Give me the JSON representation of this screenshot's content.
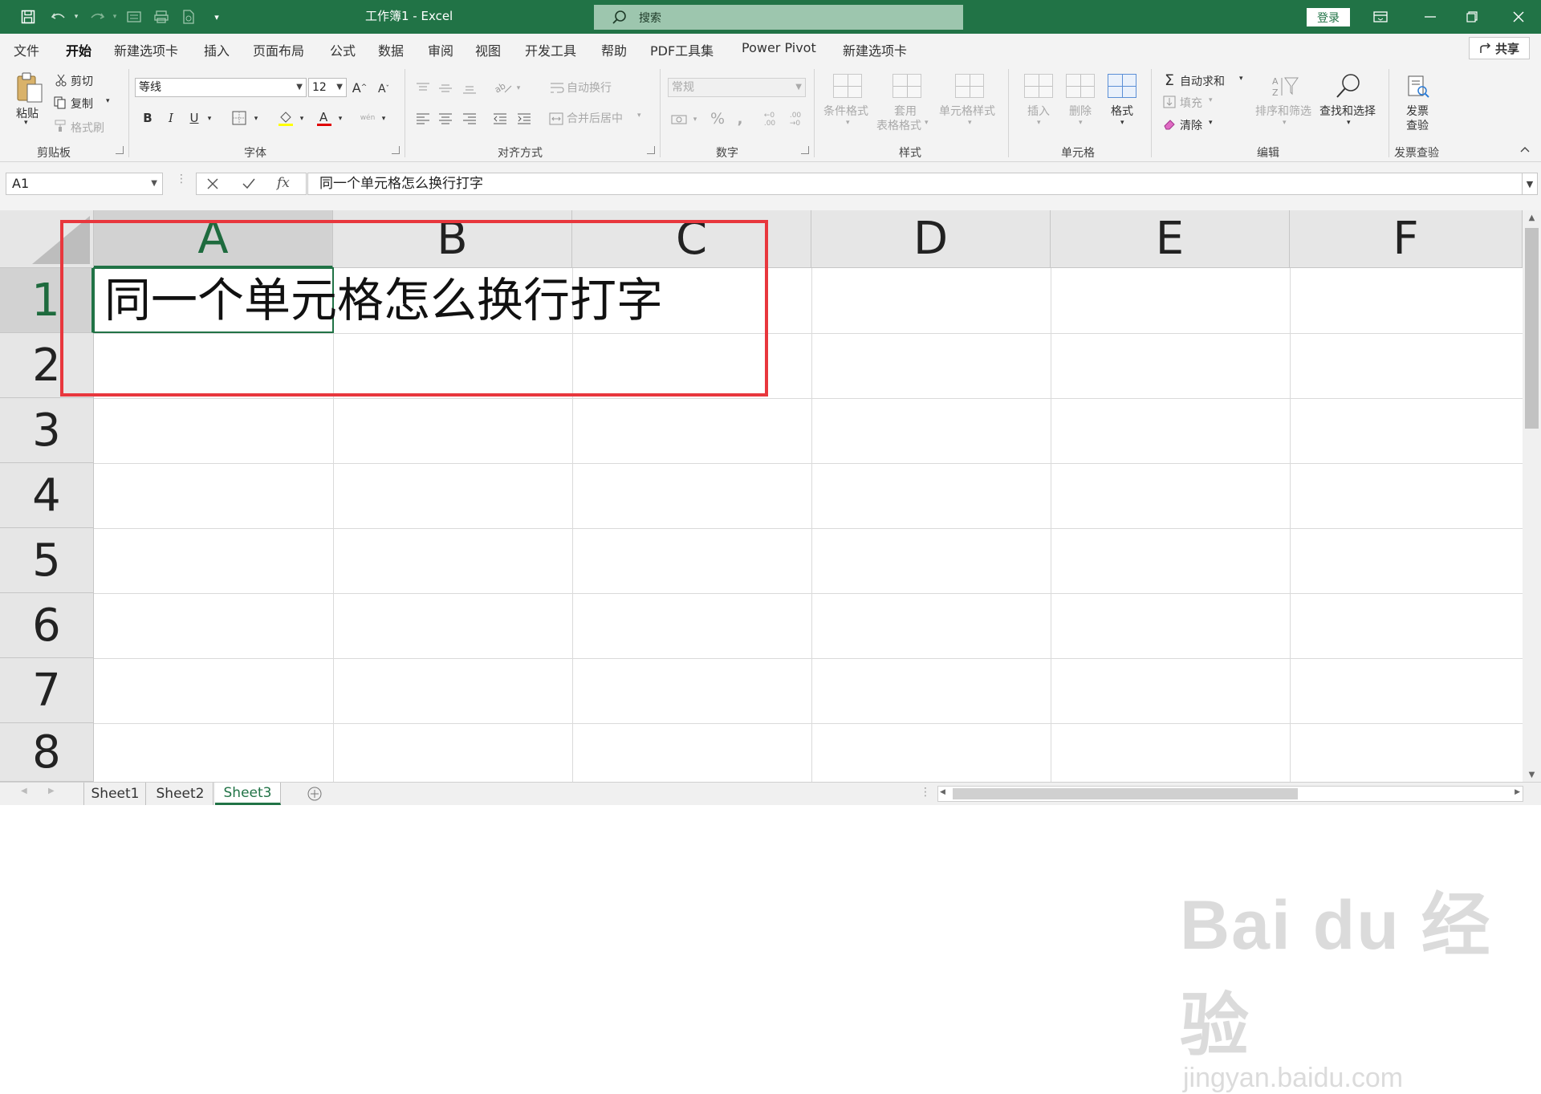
{
  "titlebar": {
    "title": "工作簿1  -  Excel",
    "search_placeholder": "搜索",
    "login_label": "登录"
  },
  "tabs": [
    "文件",
    "开始",
    "新建选项卡",
    "插入",
    "页面布局",
    "公式",
    "数据",
    "审阅",
    "视图",
    "开发工具",
    "帮助",
    "PDF工具集",
    "Power Pivot",
    "新建选项卡"
  ],
  "active_tab": "开始",
  "share_label": "共享",
  "ribbon": {
    "clipboard": {
      "paste": "粘贴",
      "cut": "剪切",
      "copy": "复制",
      "format_painter": "格式刷",
      "group": "剪贴板"
    },
    "font": {
      "name": "等线",
      "size": "12",
      "group": "字体"
    },
    "alignment": {
      "wrap": "自动换行",
      "merge": "合并后居中",
      "group": "对齐方式"
    },
    "number": {
      "format": "常规",
      "group": "数字"
    },
    "styles": {
      "conditional": "条件格式",
      "table_1": "套用",
      "table_2": "表格格式",
      "cell_styles": "单元格样式",
      "group": "样式"
    },
    "cells": {
      "insert": "插入",
      "delete": "删除",
      "format": "格式",
      "group": "单元格"
    },
    "editing": {
      "autosum": "自动求和",
      "fill": "填充",
      "clear": "清除",
      "sort": "排序和筛选",
      "find": "查找和选择",
      "group": "编辑"
    },
    "invoice": {
      "line1": "发票",
      "line2": "查验",
      "group": "发票查验"
    }
  },
  "formula_bar": {
    "name_box": "A1",
    "content": "同一个单元格怎么换行打字"
  },
  "grid": {
    "columns": [
      "A",
      "B",
      "C",
      "D",
      "E",
      "F"
    ],
    "rows": [
      "1",
      "2",
      "3",
      "4",
      "5",
      "6",
      "7",
      "8"
    ],
    "selected_cell": "A1",
    "a1_value": "同一个单元格怎么换行打字"
  },
  "sheets": [
    "Sheet1",
    "Sheet2",
    "Sheet3"
  ],
  "active_sheet": "Sheet3",
  "watermark": {
    "brand": "Bai du 经验",
    "url": "jingyan.baidu.com"
  },
  "colors": {
    "excel_green": "#217346",
    "highlight_red": "#e8373d"
  }
}
